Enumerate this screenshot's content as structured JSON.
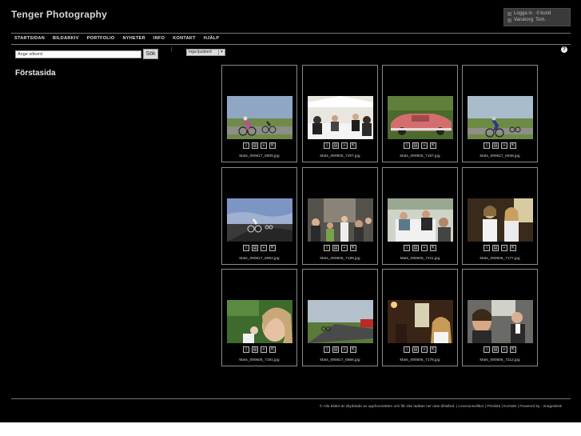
{
  "header": {
    "site_title": "Tenger Photography",
    "login_text": "Logga in · 0 kund",
    "cart_text": "Varukorg: Tom."
  },
  "nav": {
    "items": [
      "STARTSIDAN",
      "BILDARKIV",
      "PORTFOLIO",
      "NYHETER",
      "INFO",
      "KONTAKT",
      "HJÄLP"
    ]
  },
  "search": {
    "value": "Ange sökord",
    "button_label": "Sök"
  },
  "toolbar": {
    "lightbox_label": "Inga ljusbord",
    "help_label": "?",
    "separator_mark": "|"
  },
  "page": {
    "heading": "Förstasida"
  },
  "thumbnail_tools": [
    "i",
    "▤",
    "+",
    "⇱"
  ],
  "gallery": [
    {
      "filename": "Mats_090617_6909.jpg",
      "scene": "cyclists-race"
    },
    {
      "filename": "Mats_090606_7207.jpg",
      "scene": "wedding-tent"
    },
    {
      "filename": "Mats_090606_7187.jpg",
      "scene": "pink-car"
    },
    {
      "filename": "Mats_090617_6948.jpg",
      "scene": "cyclists-field"
    },
    {
      "filename": "Mats_090617_6853.jpg",
      "scene": "cyclists-road"
    },
    {
      "filename": "Mats_090606_7189.jpg",
      "scene": "crowd-stairs"
    },
    {
      "filename": "Mats_090606_7211.jpg",
      "scene": "party-table"
    },
    {
      "filename": "Mats_090606_7177.jpg",
      "scene": "women-portrait"
    },
    {
      "filename": "Mats_090606_7191.jpg",
      "scene": "woman-closeup"
    },
    {
      "filename": "Mats_090617_6866.jpg",
      "scene": "road-bus"
    },
    {
      "filename": "Mats_090606_7178.jpg",
      "scene": "bride-window"
    },
    {
      "filename": "Mats_090606_7212.jpg",
      "scene": "smiling-guests"
    }
  ],
  "footer": {
    "text": "© Alla bilder är skyddade av upphovsrätten och får inte laddas ner utan tillstånd. | Leveransvillkor | Prislista | Kontakt | Powered by : Imagedesk"
  },
  "colors": {
    "background": "#000000",
    "card_border": "#8a8a8a",
    "user_box": "#3a3a3a"
  }
}
